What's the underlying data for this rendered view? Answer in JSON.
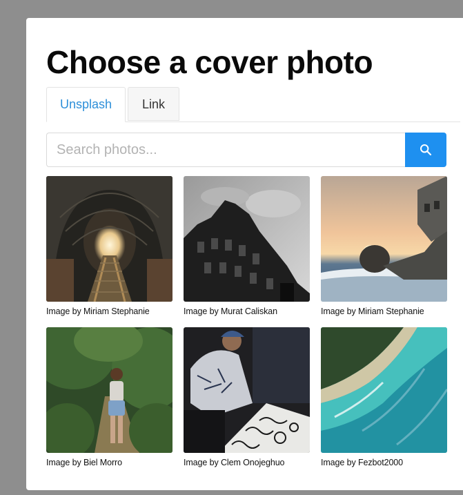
{
  "title": "Choose a cover photo",
  "tabs": [
    {
      "label": "Unsplash",
      "active": true
    },
    {
      "label": "Link",
      "active": false
    }
  ],
  "search": {
    "placeholder": "Search photos...",
    "value": "",
    "button_icon": "search-icon",
    "accent": "#1e90f0"
  },
  "photos": [
    {
      "caption": "Image by Miriam Stephanie",
      "subject": "airplane fuselage interior"
    },
    {
      "caption": "Image by Murat Caliskan",
      "subject": "gothic building facade"
    },
    {
      "caption": "Image by Miriam Stephanie",
      "subject": "plane wreck on beach at sunset"
    },
    {
      "caption": "Image by Biel Morro",
      "subject": "woman walking on forest path"
    },
    {
      "caption": "Image by Clem Onojeghuo",
      "subject": "person drawing on paper roll"
    },
    {
      "caption": "Image by Fezbot2000",
      "subject": "aerial view of coast"
    }
  ]
}
